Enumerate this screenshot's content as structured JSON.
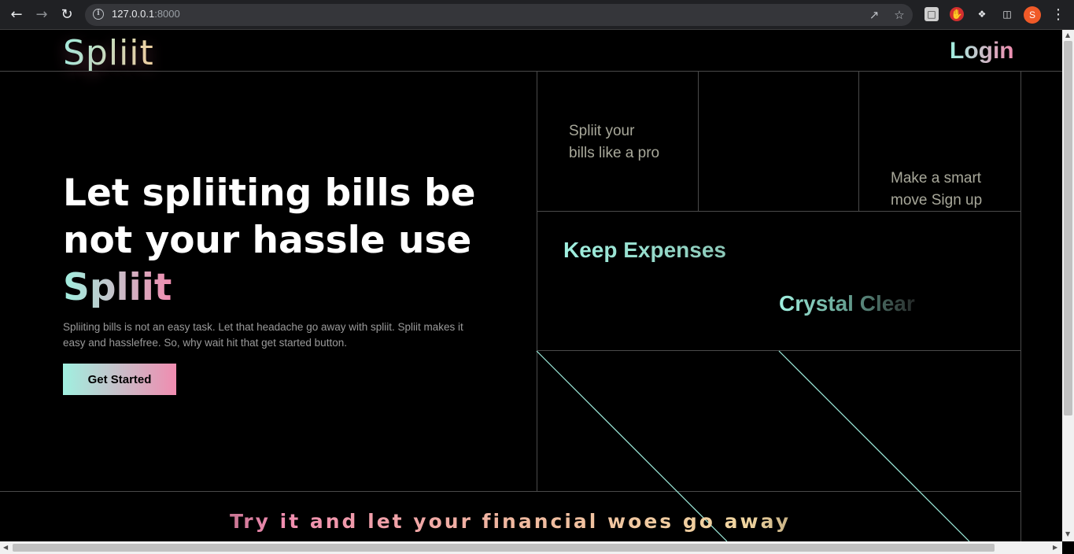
{
  "browser": {
    "url_host": "127.0.0.1",
    "url_port": ":8000",
    "profile_initial": "S"
  },
  "nav": {
    "logo": "Spliit",
    "login": "Login"
  },
  "hero": {
    "headline_line1": "Let spliiting bills be",
    "headline_line2": "not your hassle use",
    "headline_brand": "Spliit",
    "description": "Spliiting bills is not an easy task. Let that headache go away with spliit. Spliit makes it easy and hasslefree. So, why wait hit that get started button.",
    "cta_label": "Get Started"
  },
  "grid": {
    "cell1_line1": "Spliit your",
    "cell1_line2": "bills like a pro",
    "cell3_line1": "Make a smart",
    "cell3_line2": "move Sign up",
    "keep_expenses": "Keep Expenses",
    "crystal_clear": "Crystal Clear"
  },
  "footer": {
    "tagline": "Try it and let your financial woes go away"
  },
  "colors": {
    "accent_teal": "#a0f0e0",
    "accent_pink": "#f08cb0",
    "accent_gold": "#f0d5a0",
    "background": "#000000"
  }
}
